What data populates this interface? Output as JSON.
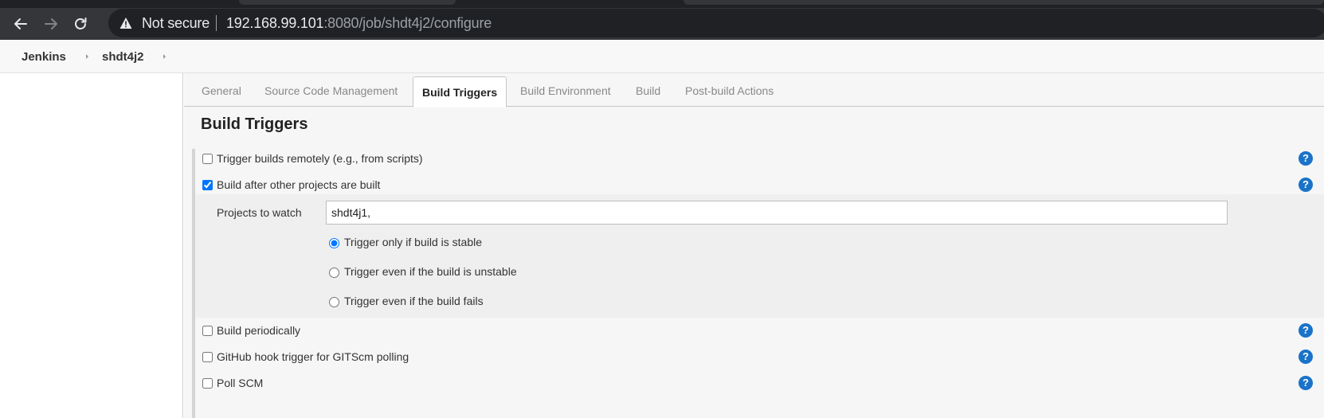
{
  "browser": {
    "security_label": "Not secure",
    "url_host": "192.168.99.101",
    "url_path": ":8080/job/shdt4j2/configure"
  },
  "breadcrumb": {
    "items": [
      "Jenkins",
      "shdt4j2"
    ]
  },
  "tabs": [
    {
      "label": "General",
      "active": false
    },
    {
      "label": "Source Code Management",
      "active": false
    },
    {
      "label": "Build Triggers",
      "active": true
    },
    {
      "label": "Build Environment",
      "active": false
    },
    {
      "label": "Build",
      "active": false
    },
    {
      "label": "Post-build Actions",
      "active": false
    }
  ],
  "section": {
    "title": "Build Triggers"
  },
  "triggers": {
    "remote": {
      "label": "Trigger builds remotely (e.g., from scripts)",
      "checked": false
    },
    "after_other": {
      "label": "Build after other projects are built",
      "checked": true
    },
    "periodically": {
      "label": "Build periodically",
      "checked": false
    },
    "github_hook": {
      "label": "GitHub hook trigger for GITScm polling",
      "checked": false
    },
    "poll_scm": {
      "label": "Poll SCM",
      "checked": false
    }
  },
  "after_other_config": {
    "projects_label": "Projects to watch",
    "projects_value": "shdt4j1,",
    "radios": [
      {
        "label": "Trigger only if build is stable",
        "selected": true
      },
      {
        "label": "Trigger even if the build is unstable",
        "selected": false
      },
      {
        "label": "Trigger even if the build fails",
        "selected": false
      }
    ]
  },
  "help_icon_text": "?",
  "colors": {
    "help_blue": "#1a73c8",
    "chrome_dark": "#202124",
    "chrome_toolbar": "#35363a"
  }
}
